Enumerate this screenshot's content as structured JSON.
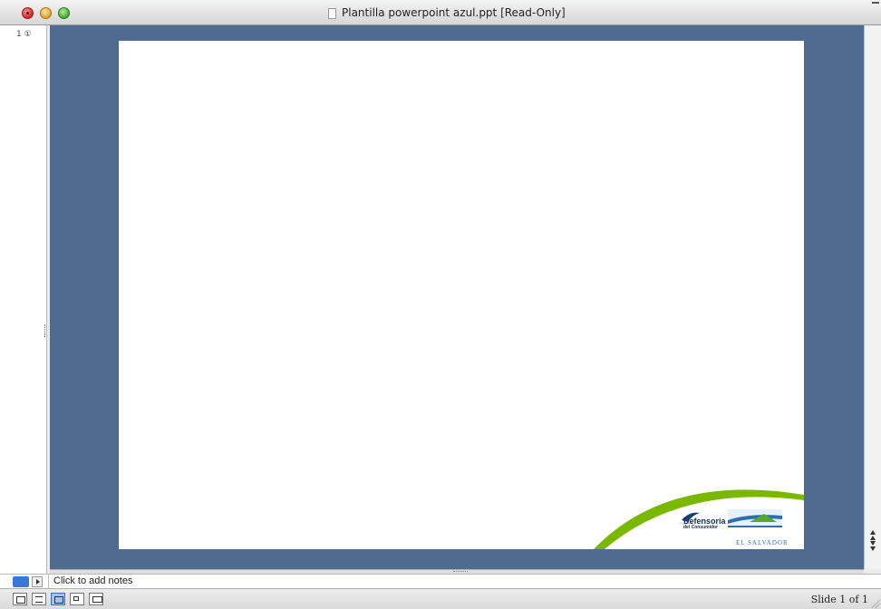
{
  "window": {
    "title": "Plantilla powerpoint azul.ppt [Read-Only]"
  },
  "thumbnails": {
    "slide_label": "1 ①"
  },
  "slide": {
    "logo_left_line1": "Defensoria",
    "logo_left_line2": "del Consumidor",
    "logo_right": "EL SALVADOR"
  },
  "notes": {
    "placeholder": "Click to add notes"
  },
  "status": {
    "slide_counter": "Slide 1 of 1"
  },
  "colors": {
    "slide_background_area": "#4f6b8f",
    "arc_green": "#7ab800",
    "notes_toggle_blue": "#3a78d8"
  },
  "icons": {
    "view_buttons": [
      "normal-view-icon",
      "outline-view-icon",
      "slide-view-icon",
      "slide-sorter-icon",
      "slide-show-icon"
    ]
  }
}
